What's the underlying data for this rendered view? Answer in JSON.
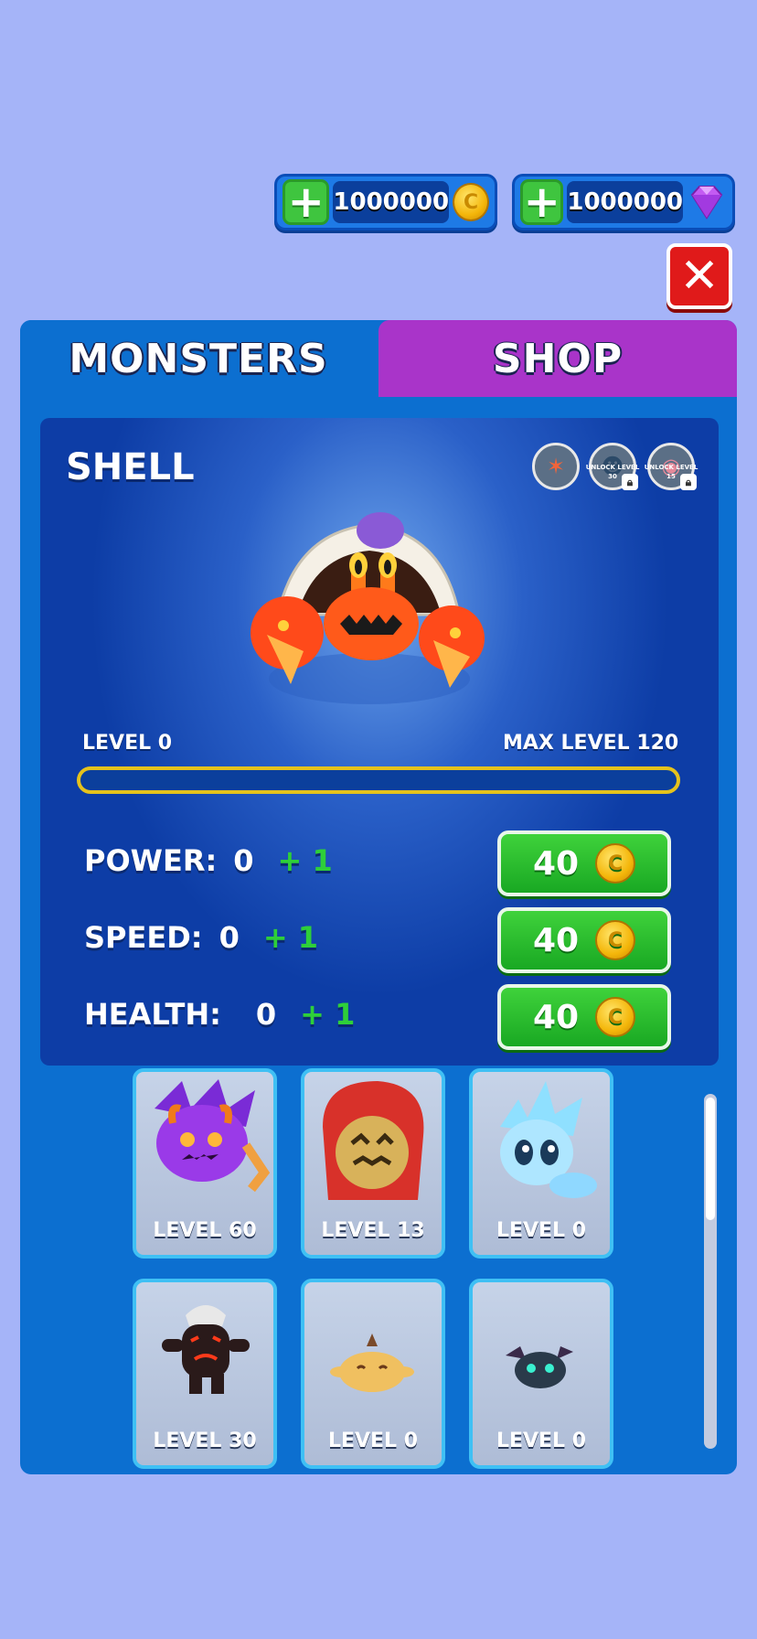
{
  "currencies": [
    {
      "amount": "1000000",
      "icon": "coin-icon",
      "coin_glyph": "C"
    },
    {
      "amount": "1000000",
      "icon": "gem-icon"
    }
  ],
  "plus_label": "+",
  "close_label": "✕",
  "tabs": {
    "monsters": "MONSTERS",
    "shop": "SHOP"
  },
  "selected_monster": {
    "name": "SHELL",
    "level_label": "LEVEL 0",
    "max_level_label": "MAX LEVEL 120",
    "level_progress": 0,
    "skins": [
      {
        "icon": "skin-icon",
        "glyph": "✶",
        "locked": false,
        "caption": ""
      },
      {
        "icon": "skin-icon",
        "glyph": "☻",
        "locked": true,
        "caption": "UNLOCK LEVEL 30"
      },
      {
        "icon": "skin-icon",
        "glyph": "◉",
        "locked": true,
        "caption": "UNLOCK LEVEL 15"
      }
    ]
  },
  "stats": [
    {
      "label": "POWER:",
      "value": "0",
      "bonus": "+ 1",
      "cost": "40"
    },
    {
      "label": "SPEED:",
      "value": "0",
      "bonus": "+ 1",
      "cost": "40"
    },
    {
      "label": "HEALTH:",
      "value": "0",
      "bonus": "+ 1",
      "cost": "40"
    }
  ],
  "monster_cards": [
    {
      "level": "LEVEL 60",
      "icon": "purple-spider-monster-icon"
    },
    {
      "level": "LEVEL 13",
      "icon": "red-hooded-monster-icon"
    },
    {
      "level": "LEVEL 0",
      "icon": "ice-spirit-monster-icon"
    },
    {
      "level": "LEVEL 30",
      "icon": "egg-shell-monster-icon"
    },
    {
      "level": "LEVEL 0",
      "icon": "bird-monster-icon"
    },
    {
      "level": "LEVEL 0",
      "icon": "bat-monster-icon"
    }
  ],
  "colors": {
    "background": "#a5b4f8",
    "panel": "#0c6fd0",
    "shop_tab": "#a934c9",
    "upgrade_green": "#19a823",
    "bar_gold": "#e5c21c"
  }
}
